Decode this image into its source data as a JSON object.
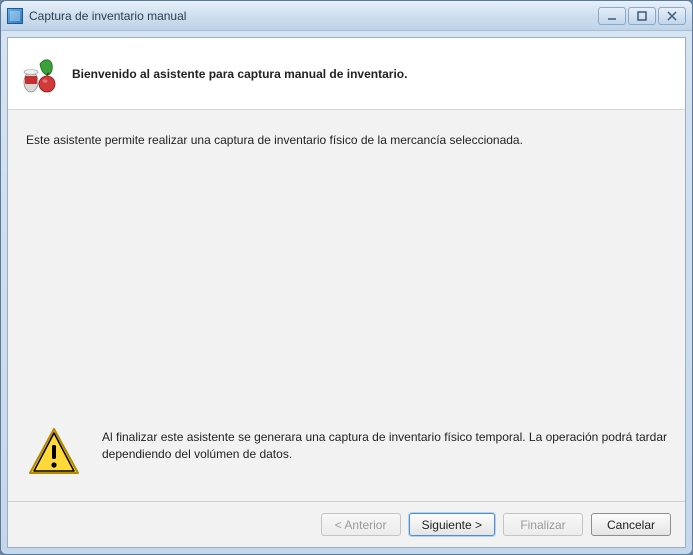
{
  "window": {
    "title": "Captura de inventario manual"
  },
  "header": {
    "headline": "Bienvenido al asistente para captura manual de inventario."
  },
  "body": {
    "intro": "Este asistente permite realizar una captura de inventario físico de la mercancía seleccionada.",
    "warning": "Al finalizar este asistente se generara una captura de inventario físico temporal. La operación podrá tardar dependiendo del volúmen de datos."
  },
  "footer": {
    "back": "< Anterior",
    "next": "Siguiente >",
    "finish": "Finalizar",
    "cancel": "Cancelar"
  }
}
